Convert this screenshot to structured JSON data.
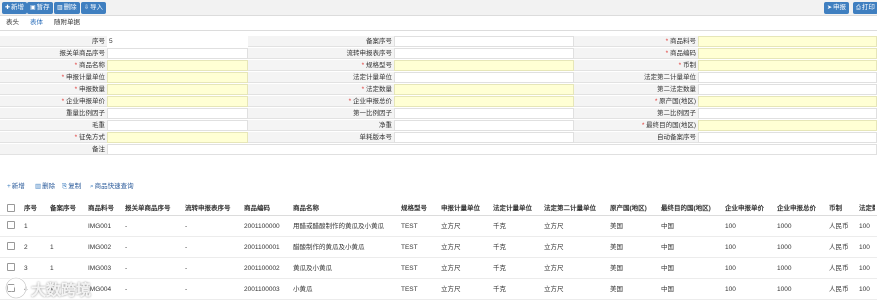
{
  "toolbar": {
    "add": "新增",
    "save": "暂存",
    "delete": "删除",
    "import": "导入",
    "declare": "申报",
    "print": "打印"
  },
  "tabs": [
    "表头",
    "表体",
    "随附单据"
  ],
  "form": {
    "rows": [
      [
        {
          "label": "序号",
          "value": "5",
          "req": false,
          "yellow": false,
          "plain": true
        },
        {
          "label": "备案序号",
          "value": "",
          "req": false,
          "yellow": false
        },
        {
          "label": "商品料号",
          "value": "",
          "req": true,
          "yellow": true
        }
      ],
      [
        {
          "label": "报关单商品序号",
          "value": "",
          "req": false,
          "yellow": false
        },
        {
          "label": "流转申报表序号",
          "value": "",
          "req": false,
          "yellow": false
        },
        {
          "label": "商品编码",
          "value": "",
          "req": true,
          "yellow": true
        }
      ],
      [
        {
          "label": "商品名称",
          "value": "",
          "req": true,
          "yellow": true
        },
        {
          "label": "规格型号",
          "value": "",
          "req": true,
          "yellow": true
        },
        {
          "label": "币制",
          "value": "",
          "req": true,
          "yellow": true
        }
      ],
      [
        {
          "label": "申报计量单位",
          "value": "",
          "req": true,
          "yellow": true
        },
        {
          "label": "法定计量单位",
          "value": "",
          "req": false,
          "yellow": false
        },
        {
          "label": "法定第二计量单位",
          "value": "",
          "req": false,
          "yellow": false
        }
      ],
      [
        {
          "label": "申报数量",
          "value": "",
          "req": true,
          "yellow": true
        },
        {
          "label": "法定数量",
          "value": "",
          "req": true,
          "yellow": true
        },
        {
          "label": "第二法定数量",
          "value": "",
          "req": false,
          "yellow": false
        }
      ],
      [
        {
          "label": "企业申报单价",
          "value": "",
          "req": true,
          "yellow": true
        },
        {
          "label": "企业申报总价",
          "value": "",
          "req": true,
          "yellow": true
        },
        {
          "label": "原产国(地区)",
          "value": "",
          "req": true,
          "yellow": true
        }
      ],
      [
        {
          "label": "重量比例因子",
          "value": "",
          "req": false,
          "yellow": false
        },
        {
          "label": "第一比例因子",
          "value": "",
          "req": false,
          "yellow": false
        },
        {
          "label": "第二比例因子",
          "value": "",
          "req": false,
          "yellow": false
        }
      ],
      [
        {
          "label": "毛重",
          "value": "",
          "req": false,
          "yellow": false
        },
        {
          "label": "净重",
          "value": "",
          "req": false,
          "yellow": false
        },
        {
          "label": "最终目的国(地区)",
          "value": "",
          "req": true,
          "yellow": true
        }
      ],
      [
        {
          "label": "征免方式",
          "value": "",
          "req": true,
          "yellow": true
        },
        {
          "label": "单耗版本号",
          "value": "",
          "req": false,
          "yellow": false
        },
        {
          "label": "自动备案序号",
          "value": "",
          "req": false,
          "yellow": false
        }
      ]
    ],
    "remark_label": "备注",
    "remark_value": ""
  },
  "subbar": {
    "add": "新增",
    "delete": "删除",
    "copy": "复制",
    "quick_query": "商品快速查询"
  },
  "table": {
    "headers": [
      "序号",
      "备案序号",
      "商品料号",
      "报关单商品序号",
      "流转申报表序号",
      "商品编码",
      "商品名称",
      "规格型号",
      "申报计量单位",
      "法定计量单位",
      "法定第二计量单位",
      "原产国(地区)",
      "最终目的国(地区)",
      "企业申报单价",
      "企业申报总价",
      "币制",
      "法定数"
    ],
    "rows": [
      [
        "1",
        "",
        "IMG001",
        "-",
        "-",
        "2001100000",
        "用醋或醋酸制作的黄瓜及小黄瓜",
        "TEST",
        "立方尺",
        "千克",
        "立方尺",
        "美国",
        "中国",
        "100",
        "1000",
        "人民币",
        "100"
      ],
      [
        "2",
        "1",
        "IMG002",
        "-",
        "-",
        "2001100001",
        "醋酸制作的黄瓜及小黄瓜",
        "TEST",
        "立方尺",
        "千克",
        "立方尺",
        "美国",
        "中国",
        "100",
        "1000",
        "人民币",
        "100"
      ],
      [
        "3",
        "1",
        "IMG003",
        "-",
        "-",
        "2001100002",
        "黄瓜及小黄瓜",
        "TEST",
        "立方尺",
        "千克",
        "立方尺",
        "美国",
        "中国",
        "100",
        "1000",
        "人民币",
        "100"
      ],
      [
        "4",
        "1",
        "IMG004",
        "-",
        "-",
        "2001100003",
        "小黄瓜",
        "TEST",
        "立方尺",
        "千克",
        "立方尺",
        "美国",
        "中国",
        "100",
        "1000",
        "人民币",
        "100"
      ]
    ]
  },
  "watermark": {
    "text": "大数跨境"
  },
  "colors": {
    "accent": "#3f7fc0",
    "required": "#e0322f",
    "required_field": "#ffffd4"
  }
}
